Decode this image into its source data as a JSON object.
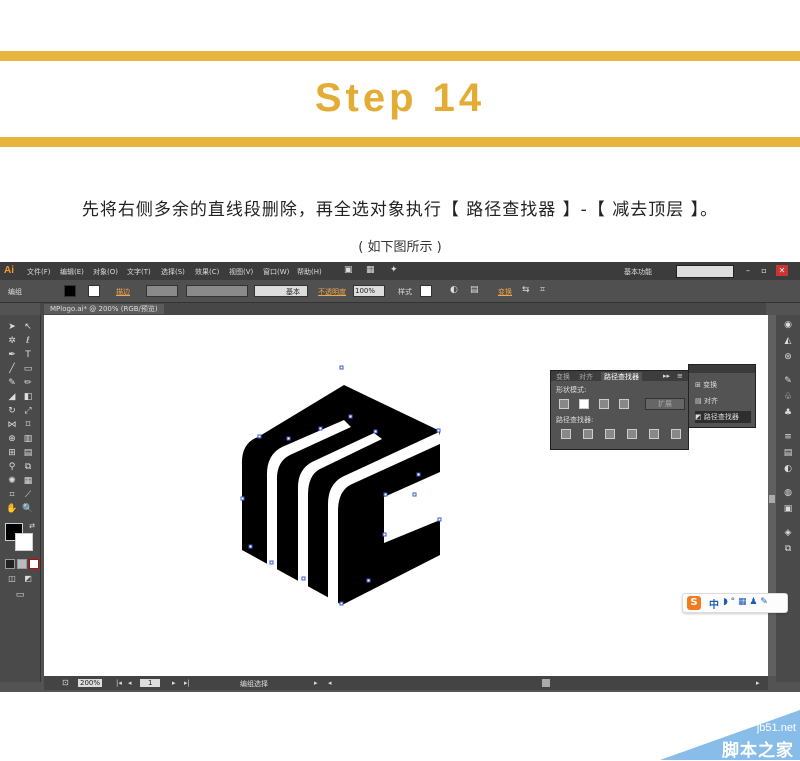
{
  "header": {
    "step_title": "Step 14",
    "instruction": "先将右侧多余的直线段删除，再全选对象执行【 路径查找器 】-【 减去顶层 】。",
    "subcaption": "( 如下图所示 )",
    "accent_color": "#e7b43d"
  },
  "app": {
    "logo": "Ai",
    "menu": [
      "文件(F)",
      "编辑(E)",
      "对象(O)",
      "文字(T)",
      "选择(S)",
      "效果(C)",
      "视图(V)",
      "窗口(W)",
      "帮助(H)"
    ],
    "workspace_label": "基本功能",
    "window_buttons": [
      "–",
      "▫",
      "✕"
    ],
    "control_bar": {
      "selection_label": "编组",
      "stroke_label": "描边",
      "stroke_style": "基本",
      "opacity_label": "不透明度",
      "opacity_value": "100%",
      "style_label": "样式",
      "transform_label": "变换"
    },
    "document_tab": "MPlogo.ai* @ 200% (RGB/预览)",
    "status_bar": {
      "zoom": "200%",
      "page": "1",
      "status_text": "编组选择"
    }
  },
  "pathfinder_panel": {
    "tabs": [
      "变换",
      "对齐",
      "路径查找器"
    ],
    "shape_modes_label": "形状模式:",
    "pathfinders_label": "路径查找器:",
    "expand_label": "扩展"
  },
  "dock_panel": {
    "items": [
      {
        "label": "变换",
        "icon": "transform-icon"
      },
      {
        "label": "对齐",
        "icon": "align-icon"
      },
      {
        "label": "路径查找器",
        "icon": "pathfinder-icon"
      }
    ]
  },
  "ime": {
    "logo": "S",
    "mode": "中"
  },
  "watermark": {
    "site": "jb51.net",
    "name": "脚本之家"
  }
}
